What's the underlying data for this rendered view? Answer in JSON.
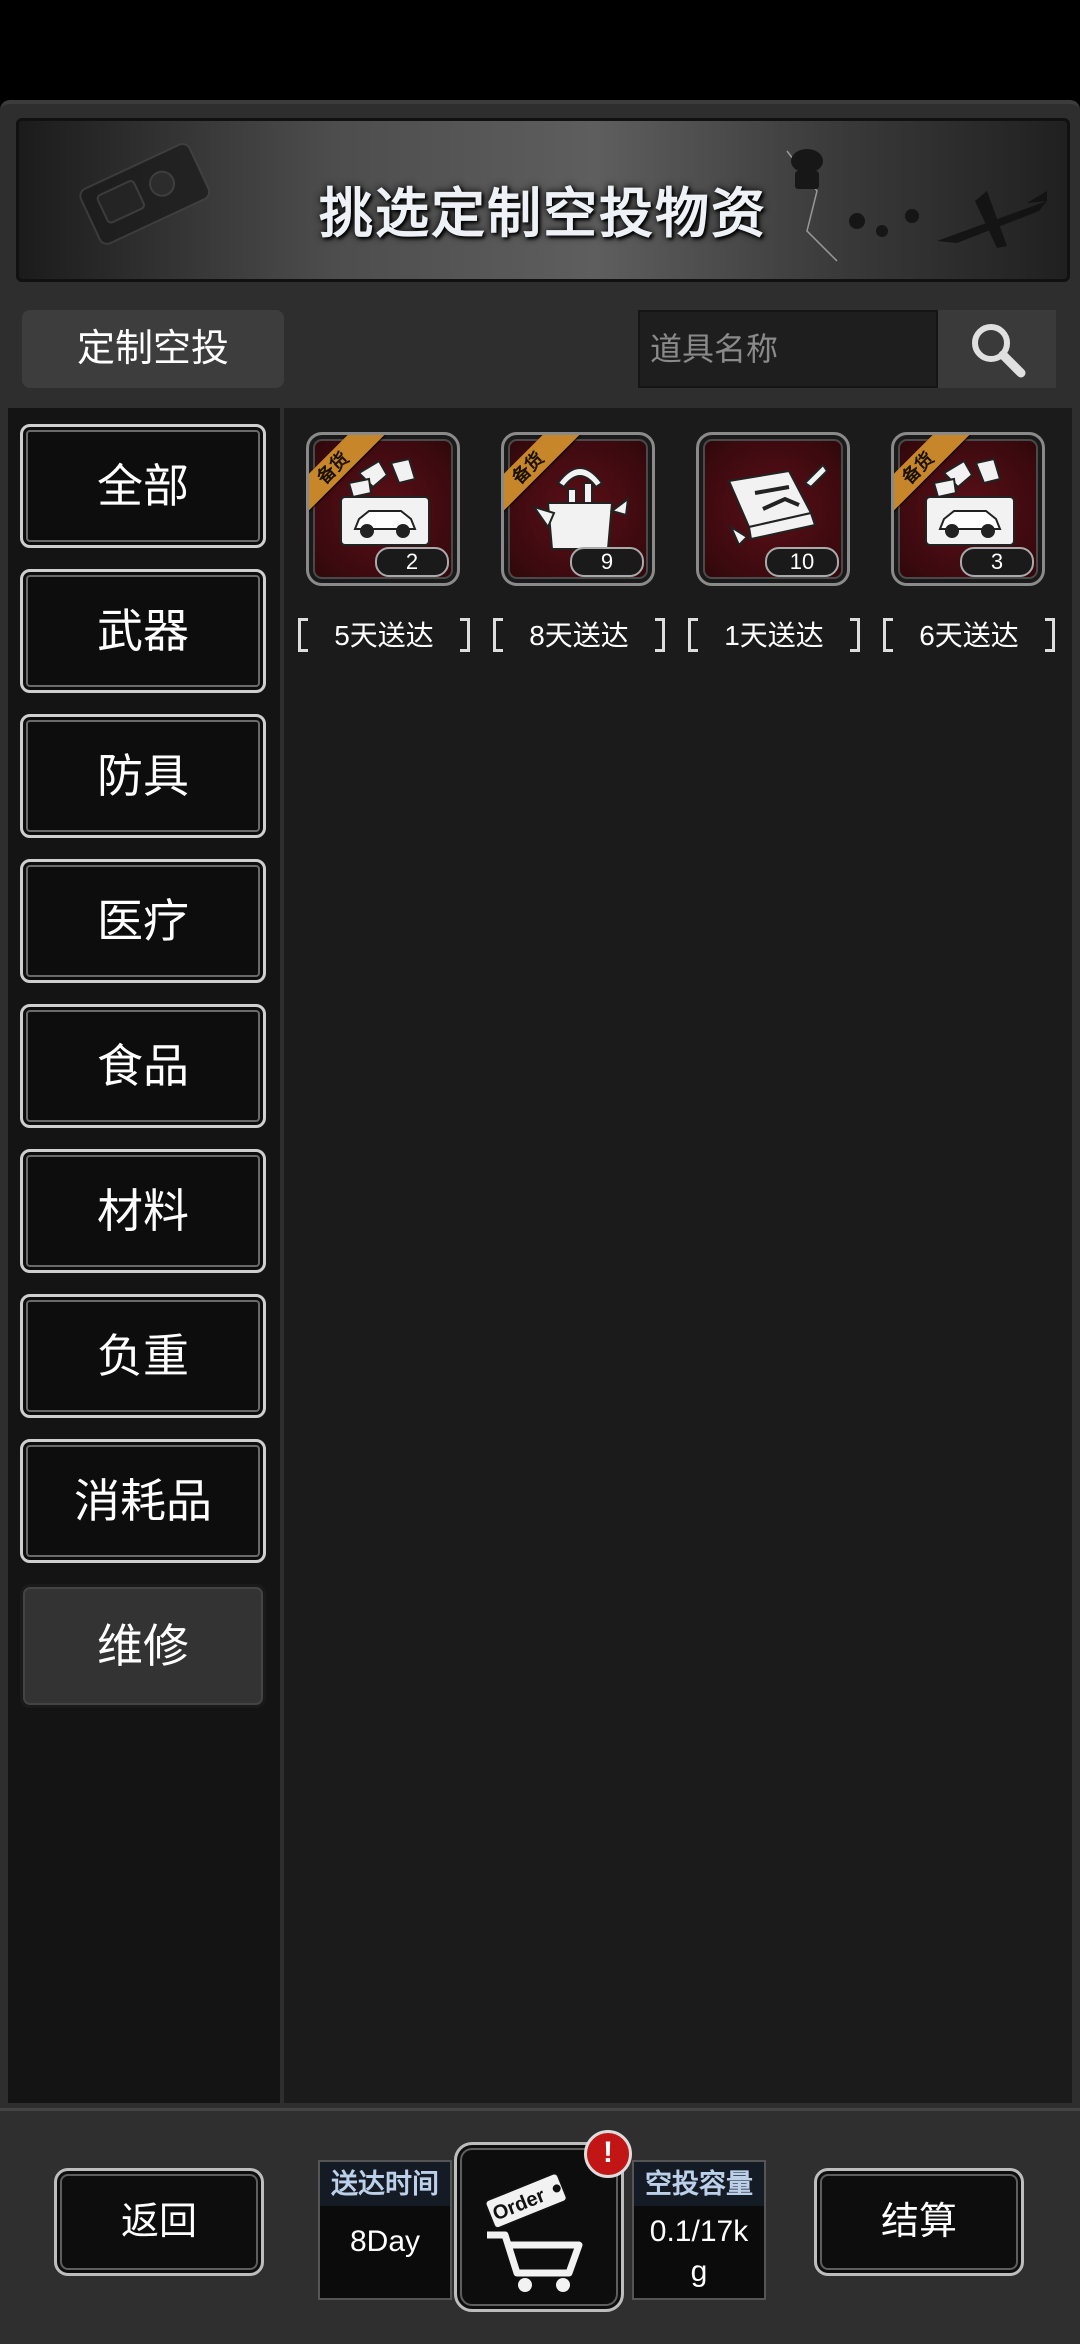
{
  "banner": {
    "title": "挑选定制空投物资"
  },
  "toolbar": {
    "tab_label": "定制空投",
    "search_placeholder": "道具名称"
  },
  "categories": [
    {
      "label": "全部",
      "active": false
    },
    {
      "label": "武器",
      "active": false
    },
    {
      "label": "防具",
      "active": false
    },
    {
      "label": "医疗",
      "active": false
    },
    {
      "label": "食品",
      "active": false
    },
    {
      "label": "材料",
      "active": false
    },
    {
      "label": "负重",
      "active": false
    },
    {
      "label": "消耗品",
      "active": false
    },
    {
      "label": "维修",
      "active": true
    }
  ],
  "items": [
    {
      "icon": "toolbox-car-icon",
      "ribbon": "备货",
      "qty": "2",
      "delivery": "5天送达"
    },
    {
      "icon": "tools-bag-icon",
      "ribbon": "备货",
      "qty": "9",
      "delivery": "8天送达"
    },
    {
      "icon": "repair-kit-icon",
      "ribbon": "",
      "qty": "10",
      "delivery": "1天送达"
    },
    {
      "icon": "toolbox-car-icon",
      "ribbon": "备货",
      "qty": "3",
      "delivery": "6天送达"
    }
  ],
  "bottom": {
    "back_label": "返回",
    "delivery_time_label": "送达时间",
    "delivery_time_value": "8Day",
    "order_label": "Order",
    "alert": "!",
    "capacity_label": "空投容量",
    "capacity_value_line1": "0.1/17k",
    "capacity_value_line2": "g",
    "checkout_label": "结算"
  },
  "colors": {
    "tile_red": "#5a0f16",
    "ribbon_gold": "#c8862a",
    "alert_red": "#c21616",
    "info_label_text": "#bcd0ea"
  }
}
